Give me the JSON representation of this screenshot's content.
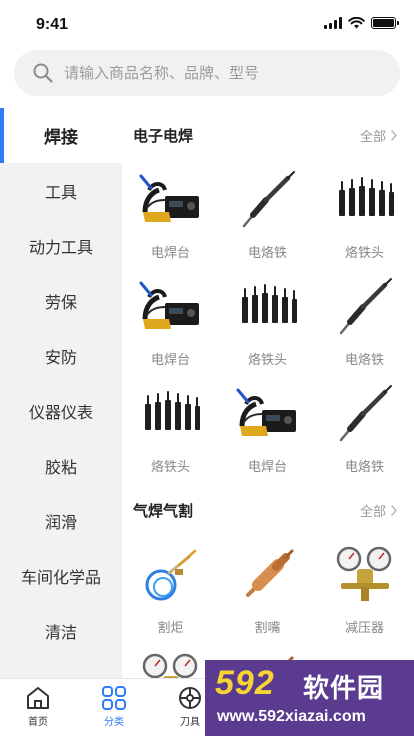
{
  "status": {
    "time": "9:41"
  },
  "search": {
    "placeholder": "请输入商品名称、品牌、型号"
  },
  "sidebar": {
    "items": [
      {
        "label": "焊接",
        "active": true
      },
      {
        "label": "工具"
      },
      {
        "label": "动力工具"
      },
      {
        "label": "劳保"
      },
      {
        "label": "安防"
      },
      {
        "label": "仪器仪表"
      },
      {
        "label": "胶粘"
      },
      {
        "label": "润滑"
      },
      {
        "label": "车间化学品"
      },
      {
        "label": "清洁"
      }
    ]
  },
  "sections": [
    {
      "title": "电子电焊",
      "more": "全部",
      "items": [
        {
          "label": "电焊台",
          "icon": "soldering-station-icon"
        },
        {
          "label": "电烙铁",
          "icon": "soldering-iron-icon"
        },
        {
          "label": "烙铁头",
          "icon": "soldering-tips-icon"
        },
        {
          "label": "电焊台",
          "icon": "soldering-station-icon"
        },
        {
          "label": "烙铁头",
          "icon": "soldering-tips-icon"
        },
        {
          "label": "电烙铁",
          "icon": "soldering-iron-icon"
        },
        {
          "label": "烙铁头",
          "icon": "soldering-tips-icon"
        },
        {
          "label": "电焊台",
          "icon": "soldering-station-icon"
        },
        {
          "label": "电烙铁",
          "icon": "soldering-iron-icon"
        }
      ]
    },
    {
      "title": "气焊气割",
      "more": "全部",
      "items": [
        {
          "label": "割炬",
          "icon": "cutting-torch-icon"
        },
        {
          "label": "割嘴",
          "icon": "cutting-nozzle-icon"
        },
        {
          "label": "减压器",
          "icon": "pressure-regulator-icon"
        }
      ]
    }
  ],
  "tabbar": {
    "items": [
      {
        "label": "首页",
        "icon": "home-icon"
      },
      {
        "label": "分类",
        "icon": "category-icon",
        "active": true
      },
      {
        "label": "刀具",
        "icon": "tool-icon"
      }
    ]
  },
  "watermark": {
    "logo": "592",
    "text": "软件园",
    "url": "www.592xiazai.com"
  },
  "colors": {
    "accent": "#2f7cf6",
    "sidebar_bg": "#f2f2f2",
    "search_bg": "#f1f1f1"
  }
}
